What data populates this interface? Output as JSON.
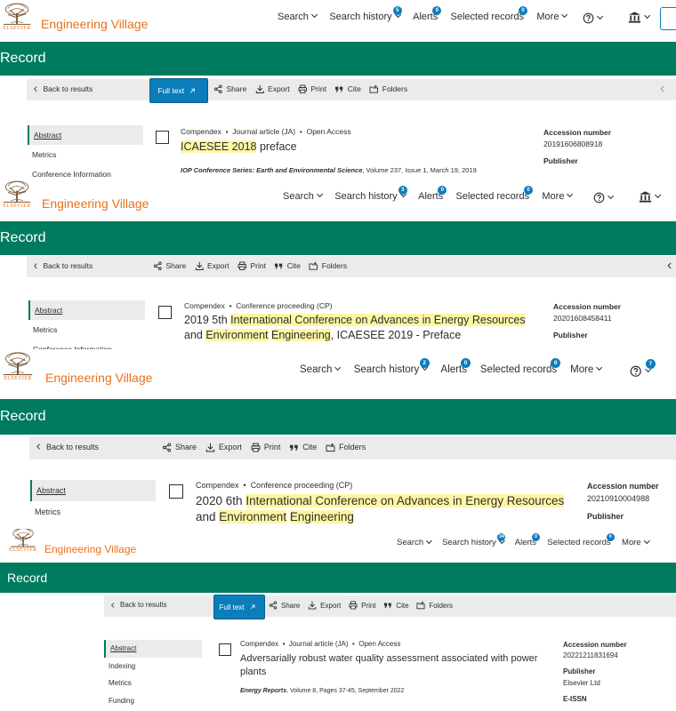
{
  "brand": {
    "name": "Engineering Village",
    "publisher": "ELSEVIER"
  },
  "nav": {
    "search": "Search",
    "search_history": "Search history",
    "alerts": "Alerts",
    "selected_records": "Selected records",
    "more": "More"
  },
  "record_label": "Record",
  "toolbar": {
    "back": "Back to results",
    "full_text": "Full text",
    "share": "Share",
    "export": "Export",
    "print": "Print",
    "cite": "Cite",
    "folders": "Folders"
  },
  "panels": [
    {
      "badges": {
        "search_history": "5",
        "alerts": "0",
        "selected_records": "0"
      },
      "sidebar": [
        "Abstract",
        "Metrics",
        "Conference Information"
      ],
      "db": "Compendex",
      "doc_type": "Journal article (JA)",
      "access": "Open Access",
      "title_parts": [
        {
          "t": "ICAESEE 2018",
          "hl": true
        },
        {
          "t": " preface",
          "hl": false
        }
      ],
      "source": "IOP Conference Series: Earth and Environmental Science",
      "source_details": ", Volume 237, Issue 1, March 19, 2019",
      "accession_label": "Accession number",
      "accession": "20191606808918",
      "publisher_label": "Publisher"
    },
    {
      "badges": {
        "search_history": "3",
        "alerts": "0",
        "selected_records": "0"
      },
      "sidebar": [
        "Abstract",
        "Metrics",
        "Conference Information"
      ],
      "db": "Compendex",
      "doc_type": "Conference proceeding (CP)",
      "title_parts": [
        {
          "t": "2019 5th ",
          "hl": false
        },
        {
          "t": "International Conference on Advances in Energy Resources",
          "hl": true
        },
        {
          "t": " and ",
          "hl": false
        },
        {
          "t": "Environment",
          "hl": true
        },
        {
          "t": " ",
          "hl": false
        },
        {
          "t": "Engineering",
          "hl": true
        },
        {
          "t": ", ICAESEE 2019 - Preface",
          "hl": false
        }
      ],
      "accession_label": "Accession number",
      "accession": "20201608458411",
      "publisher_label": "Publisher"
    },
    {
      "badges": {
        "search_history": "2",
        "alerts": "0",
        "selected_records": "0",
        "help": "7"
      },
      "sidebar": [
        "Abstract",
        "Metrics"
      ],
      "db": "Compendex",
      "doc_type": "Conference proceeding (CP)",
      "title_parts": [
        {
          "t": "2020 6th ",
          "hl": false
        },
        {
          "t": "International Conference on Advances in Energy Resources",
          "hl": true
        },
        {
          "t": " and ",
          "hl": false
        },
        {
          "t": "Environment",
          "hl": true
        },
        {
          "t": " ",
          "hl": false
        },
        {
          "t": "Engineering",
          "hl": true
        }
      ],
      "accession_label": "Accession number",
      "accession": "20210910004988",
      "publisher_label": "Publisher"
    },
    {
      "badges": {
        "search_history": "34",
        "alerts": "0",
        "selected_records": "0"
      },
      "sidebar": [
        "Abstract",
        "Indexing",
        "Metrics",
        "Funding"
      ],
      "db": "Compendex",
      "doc_type": "Journal article (JA)",
      "access": "Open Access",
      "title_parts": [
        {
          "t": "Adversarially robust water quality assessment associated with power plants",
          "hl": false
        }
      ],
      "source": "Energy Reports",
      "source_details": ", Volume 8, Pages 37-45, September 2022",
      "accession_label": "Accession number",
      "accession": "20221211831694",
      "publisher_label": "Publisher",
      "publisher": "Elsevier Ltd",
      "eissn_label": "E-ISSN"
    }
  ]
}
